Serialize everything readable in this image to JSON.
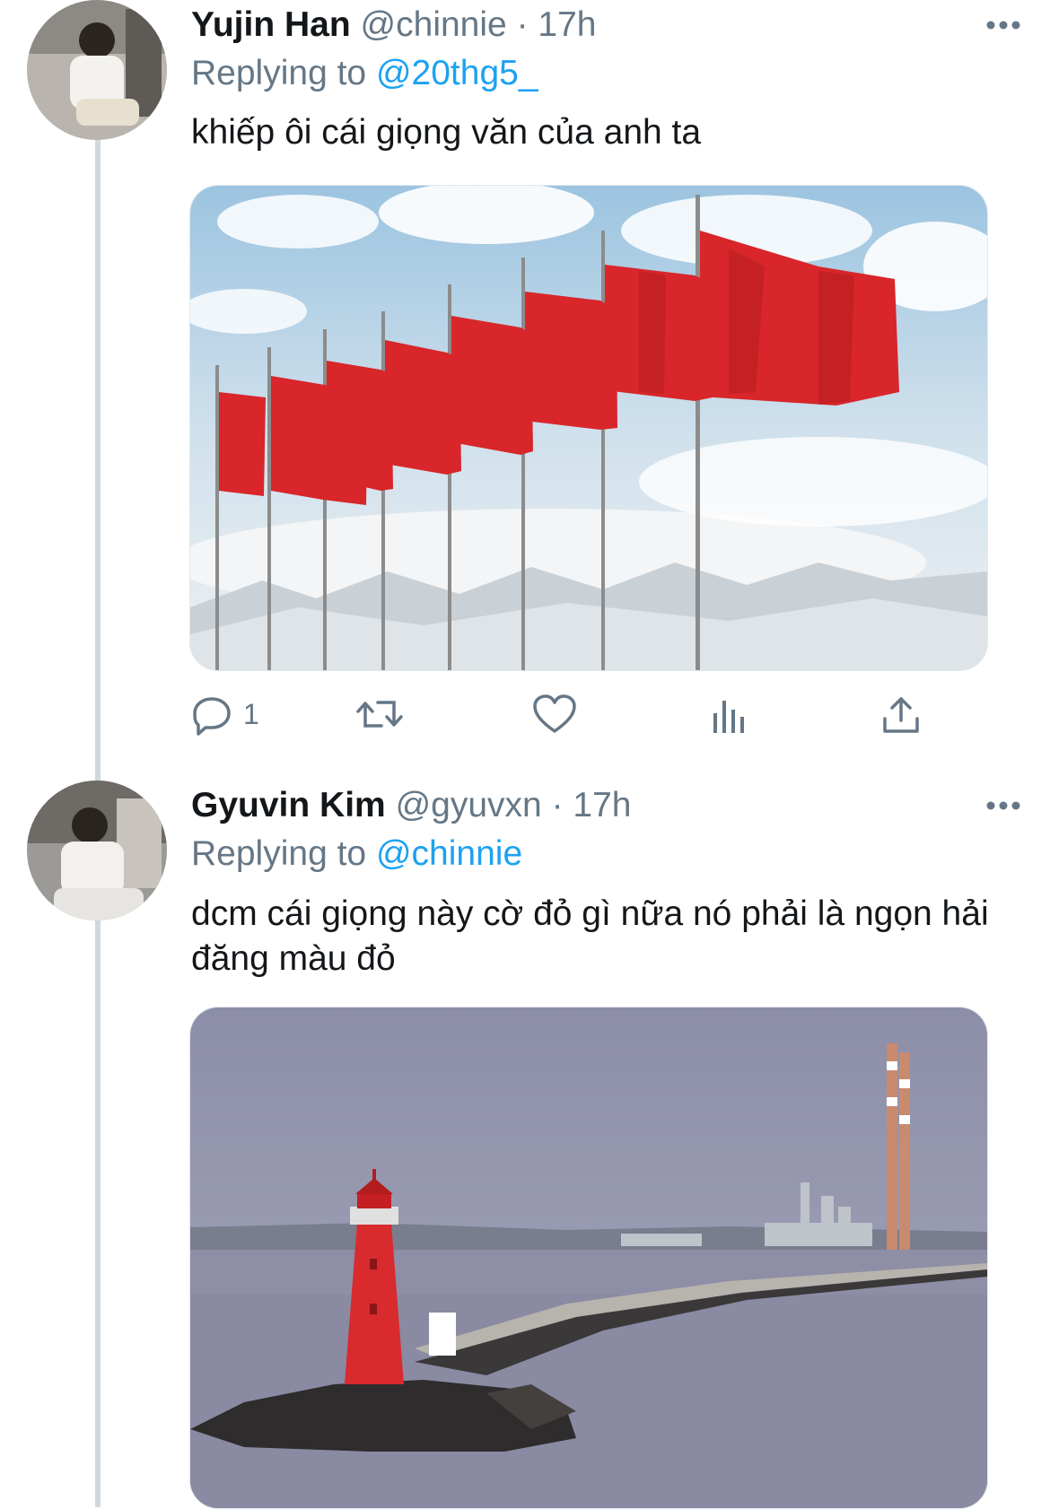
{
  "tweets": [
    {
      "name": "Yujin Han",
      "handle": "@chinnie",
      "separator": "·",
      "time": "17h",
      "replying_prefix": "Replying to ",
      "replying_to": "@20thg5_",
      "text": "khiếp ôi cái giọng văn của anh ta",
      "media_icon": "red-flags-photo",
      "actions": {
        "reply_count": "1"
      }
    },
    {
      "name": "Gyuvin Kim",
      "handle": "@gyuvxn",
      "separator": "·",
      "time": "17h",
      "replying_prefix": "Replying to ",
      "replying_to": "@chinnie",
      "text": "dcm cái giọng này cờ đỏ gì nữa nó phải là ngọn hải đăng màu đỏ",
      "media_icon": "red-lighthouse-photo"
    }
  ],
  "colors": {
    "accent": "#1da1f2",
    "secondary_text": "#657786",
    "primary_text": "#14171a",
    "thread_line": "#cfd9de"
  }
}
